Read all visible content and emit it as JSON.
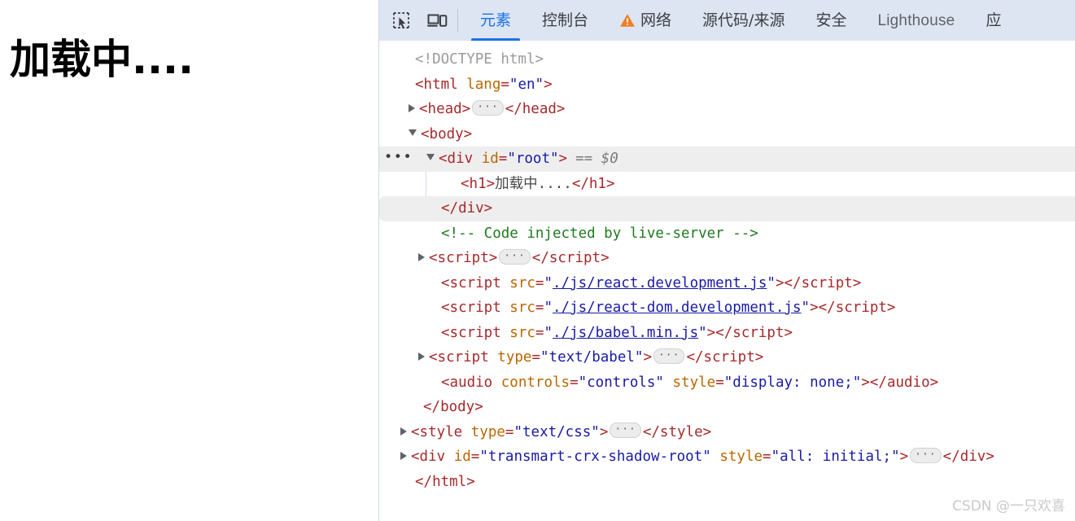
{
  "page": {
    "heading": "加载中...."
  },
  "devtools": {
    "toolbar": {
      "icons": [
        {
          "name": "inspect-element-icon",
          "title": "检查元素"
        },
        {
          "name": "device-toolbar-icon",
          "title": "切换设备工具栏"
        }
      ],
      "tabs": [
        {
          "label": "元素",
          "active": true,
          "warning": false,
          "latin": false
        },
        {
          "label": "控制台",
          "active": false,
          "warning": false,
          "latin": false
        },
        {
          "label": "网络",
          "active": false,
          "warning": true,
          "latin": false
        },
        {
          "label": "源代码/来源",
          "active": false,
          "warning": false,
          "latin": false
        },
        {
          "label": "安全",
          "active": false,
          "warning": false,
          "latin": false
        },
        {
          "label": "Lighthouse",
          "active": false,
          "warning": false,
          "latin": true
        },
        {
          "label": "应",
          "active": false,
          "warning": false,
          "latin": false
        }
      ]
    },
    "colors": {
      "toolbar_bg": "#dee5f2",
      "active_tab": "#1a73e8",
      "inactive_tab": "#3c4043",
      "warning": "#ec8026",
      "tag": "#a8292b",
      "attr_name": "#bb6600",
      "attr_value": "#1a1aa6",
      "comment": "#1f7a1f",
      "doctype": "#9a9a9a",
      "selected_row": "#eeeeee"
    },
    "dom_rows": [
      {
        "id": "doctype",
        "text": "<!DOCTYPE html>"
      },
      {
        "id": "html-open",
        "tag_open": "<html ",
        "attr": "lang",
        "val": "\"en\"",
        "tag_close": ">"
      },
      {
        "id": "head",
        "text": "<head>",
        "close": "</head>"
      },
      {
        "id": "body-open",
        "text": "<body>"
      },
      {
        "id": "div-root",
        "tag_open": "<div ",
        "attr": "id",
        "val": "\"root\"",
        "tag_close": ">",
        "marker": "== $0"
      },
      {
        "id": "h1",
        "open": "<h1>",
        "content": "加载中....",
        "close": "</h1>"
      },
      {
        "id": "div-close",
        "text": "</div>"
      },
      {
        "id": "comment",
        "text": "<!-- Code injected by live-server -->"
      },
      {
        "id": "script-inline",
        "text": "<script>",
        "close": "</script>"
      },
      {
        "id": "script-react",
        "tag_open": "<script ",
        "attr": "src",
        "link": "./js/react.development.js",
        "tag_close": ">",
        "close": "</script>"
      },
      {
        "id": "script-react-dom",
        "tag_open": "<script ",
        "attr": "src",
        "link": "./js/react-dom.development.js",
        "tag_close": ">",
        "close": "</script>"
      },
      {
        "id": "script-babel",
        "tag_open": "<script ",
        "attr": "src",
        "link": "./js/babel.min.js",
        "tag_close": ">",
        "close": "</script>"
      },
      {
        "id": "script-text-babel",
        "tag_open": "<script ",
        "attr": "type",
        "val": "\"text/babel\"",
        "tag_close": ">",
        "close": "</script>"
      },
      {
        "id": "audio",
        "tag_open": "<audio ",
        "attr": "controls",
        "val": "\"controls\"",
        "attr2": "style",
        "val2": "\"display: none;\"",
        "tag_close": ">",
        "close": "</audio>"
      },
      {
        "id": "body-close",
        "text": "</body>"
      },
      {
        "id": "style",
        "tag_open": "<style ",
        "attr": "type",
        "val": "\"text/css\"",
        "tag_close": ">",
        "close": "</style>"
      },
      {
        "id": "div-transmart",
        "tag_open": "<div ",
        "attr": "id",
        "val": "\"transmart-crx-shadow-root\"",
        "attr2": "style",
        "val2": "\"all: initial;\"",
        "tag_close": ">",
        "close": "</div>"
      },
      {
        "id": "html-close",
        "text": "</html>"
      }
    ]
  },
  "watermark": "CSDN @一只欢喜"
}
